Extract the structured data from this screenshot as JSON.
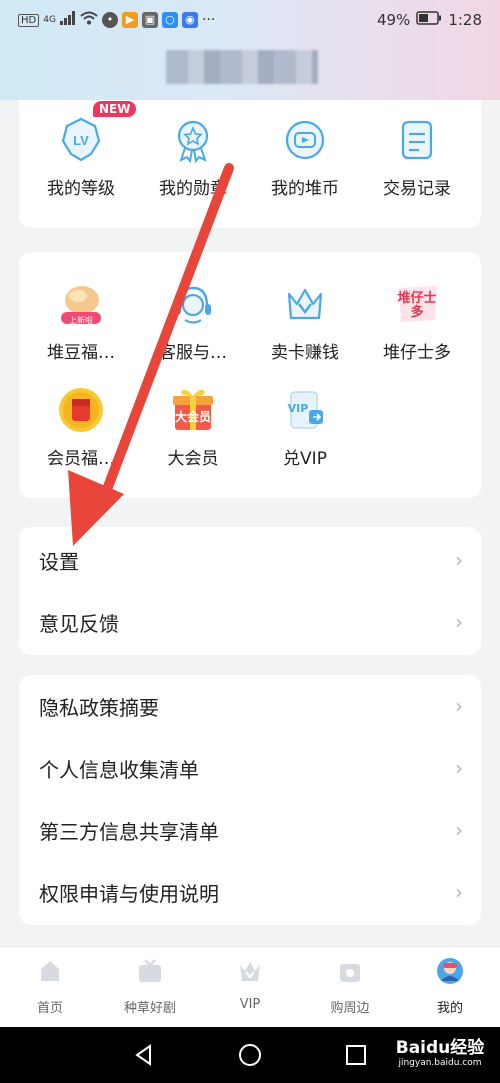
{
  "status_bar": {
    "left_label": "HD",
    "net_label": "4G",
    "battery": "49%",
    "time": "1:28"
  },
  "badge": {
    "new": "NEW"
  },
  "card1": [
    {
      "label": "我的等级"
    },
    {
      "label": "我的勋章"
    },
    {
      "label": "我的堆币"
    },
    {
      "label": "交易记录"
    }
  ],
  "card2": [
    {
      "label": "堆豆福…",
      "icon_text": "上新啦"
    },
    {
      "label": "客服与…"
    },
    {
      "label": "卖卡赚钱"
    },
    {
      "label": "堆仔士多",
      "icon_text": "堆仔士多"
    },
    {
      "label": "会员福…"
    },
    {
      "label": "大会员",
      "icon_text": "大会员"
    },
    {
      "label": "兑VIP",
      "icon_text": "VIP"
    }
  ],
  "list1": [
    {
      "label": "设置"
    },
    {
      "label": "意见反馈"
    }
  ],
  "list2": [
    {
      "label": "隐私政策摘要"
    },
    {
      "label": "个人信息收集清单"
    },
    {
      "label": "第三方信息共享清单"
    },
    {
      "label": "权限申请与使用说明"
    }
  ],
  "bottom_nav": [
    {
      "label": "首页"
    },
    {
      "label": "种草好剧"
    },
    {
      "label": "VIP"
    },
    {
      "label": "购周边"
    },
    {
      "label": "我的"
    }
  ],
  "watermark": {
    "line1": "Baidu经验",
    "line2": "jingyan.baidu.com"
  },
  "colors": {
    "accent": "#4aa8e8",
    "arrow": "#e8463a",
    "badge": "#f0355e"
  }
}
